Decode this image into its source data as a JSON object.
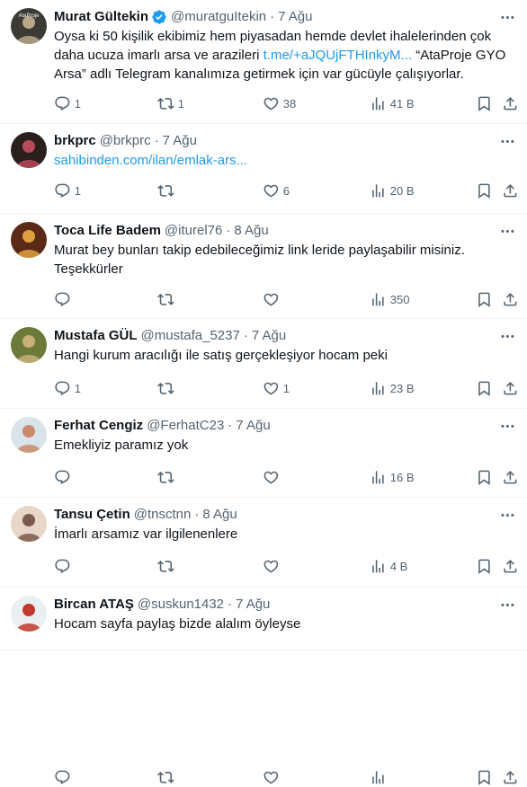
{
  "tweets": [
    {
      "name": "Murat Gültekin",
      "verified": true,
      "handle": "@muratguItekin",
      "date": "7 Ağu",
      "text_before": "Oysa ki 50 kişilik ekibimiz hem piyasadan hemde devlet ihalelerinden çok daha ucuza imarlı arsa ve arazileri ",
      "link": "t.me/+aJQUjFTHInkyM...",
      "text_after": " “AtaProje GYO Arsa” adlı Telegram kanalımıza getirmek için var gücüyle çalışıyorlar.",
      "replies": "1",
      "retweets": "1",
      "likes": "38",
      "views": "41 B",
      "avatar_colors": [
        "#3b3a35",
        "#b9a98a"
      ],
      "avatar_text": "AtaProje"
    },
    {
      "name": "brkprc",
      "verified": false,
      "handle": "@brkprc",
      "date": "7 Ağu",
      "text_before": "",
      "link": "sahibinden.com/ilan/emlak-ars...",
      "text_after": "",
      "replies": "1",
      "retweets": "",
      "likes": "6",
      "views": "20 B",
      "avatar_colors": [
        "#2a1f1d",
        "#b84a5a"
      ],
      "avatar_text": ""
    },
    {
      "name": "Toca Life Badem",
      "verified": false,
      "handle": "@iturel76",
      "date": "8 Ağu",
      "text_before": "Murat bey bunları takip edebileceğimiz link leride paylaşabilir misiniz. Teşekkürler",
      "link": "",
      "text_after": "",
      "replies": "",
      "retweets": "",
      "likes": "",
      "views": "350",
      "avatar_colors": [
        "#5a2a16",
        "#e0a040"
      ],
      "avatar_text": ""
    },
    {
      "name": "Mustafa GÜL",
      "verified": false,
      "handle": "@mustafa_5237",
      "date": "7 Ağu",
      "text_before": "Hangi kurum aracılığı ile satış gerçekleşiyor hocam peki",
      "link": "",
      "text_after": "",
      "replies": "1",
      "retweets": "",
      "likes": "1",
      "views": "23 B",
      "avatar_colors": [
        "#6b7a3a",
        "#c9b07a"
      ],
      "avatar_text": ""
    },
    {
      "name": "Ferhat Cengiz",
      "verified": false,
      "handle": "@FerhatC23",
      "date": "7 Ağu",
      "text_before": "Emekliyiz paramız yok",
      "link": "",
      "text_after": "",
      "replies": "",
      "retweets": "",
      "likes": "",
      "views": "16 B",
      "avatar_colors": [
        "#d8e3ea",
        "#c98a6a"
      ],
      "avatar_text": ""
    },
    {
      "name": "Tansu Çetin",
      "verified": false,
      "handle": "@tnsctnn",
      "date": "8 Ağu",
      "text_before": "İmarlı arsamız var ilgilenenlere",
      "link": "",
      "text_after": "",
      "replies": "",
      "retweets": "",
      "likes": "",
      "views": "4 B",
      "avatar_colors": [
        "#e8d7c8",
        "#7a5a4a"
      ],
      "avatar_text": ""
    },
    {
      "name": "Bircan ATAŞ",
      "verified": false,
      "handle": "@suskun1432",
      "date": "7 Ağu",
      "text_before": "Hocam sayfa paylaş bizde alalım öyleyse",
      "link": "",
      "text_after": "",
      "replies": "",
      "retweets": "",
      "likes": "",
      "views": "",
      "avatar_colors": [
        "#eaf0f2",
        "#c0392b"
      ],
      "avatar_text": ""
    }
  ]
}
